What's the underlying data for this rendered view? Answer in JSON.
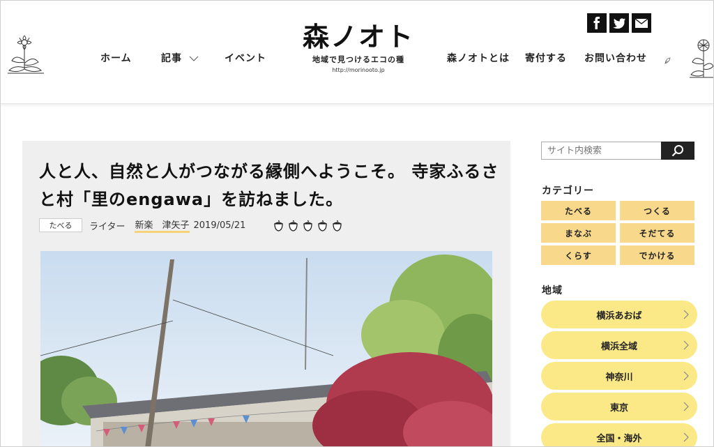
{
  "header": {
    "logo_title": "森ノオト",
    "logo_tagline": "地域で見つけるエコの種",
    "logo_url": "http://morinooto.jp",
    "nav_left": [
      {
        "label": "ホーム"
      },
      {
        "label": "記事"
      },
      {
        "label": "イベント"
      }
    ],
    "nav_right": [
      {
        "label": "森ノオトとは"
      },
      {
        "label": "寄付する"
      },
      {
        "label": "お問い合わせ"
      }
    ],
    "sns": [
      {
        "label": "f",
        "icon": "facebook-icon"
      },
      {
        "label": "twitter",
        "icon": "twitter-icon"
      },
      {
        "label": "mail",
        "icon": "mail-icon"
      }
    ]
  },
  "article": {
    "title": "人と人、自然と人がつながる縁側へようこそ。 寺家ふるさと村「里のengawa」を訪ねました。",
    "category": "たべる",
    "writer_label": "ライター",
    "writer_name": "新楽　津矢子",
    "date": "2019/05/21",
    "acorn_count": 5
  },
  "sidebar": {
    "search_placeholder": "サイト内検索",
    "category_heading": "カテゴリー",
    "categories": [
      {
        "label": "たべる"
      },
      {
        "label": "つくる"
      },
      {
        "label": "まなぶ"
      },
      {
        "label": "そだてる"
      },
      {
        "label": "くらす"
      },
      {
        "label": "でかける"
      }
    ],
    "region_heading": "地域",
    "regions": [
      {
        "label": "横浜あおば"
      },
      {
        "label": "横浜全域"
      },
      {
        "label": "神奈川"
      },
      {
        "label": "東京"
      },
      {
        "label": "全国・海外"
      }
    ]
  },
  "colors": {
    "category_bg": "#f8d88a",
    "region_bg": "#fbe887",
    "underline": "#f6d27a",
    "card_bg": "#efefef"
  }
}
